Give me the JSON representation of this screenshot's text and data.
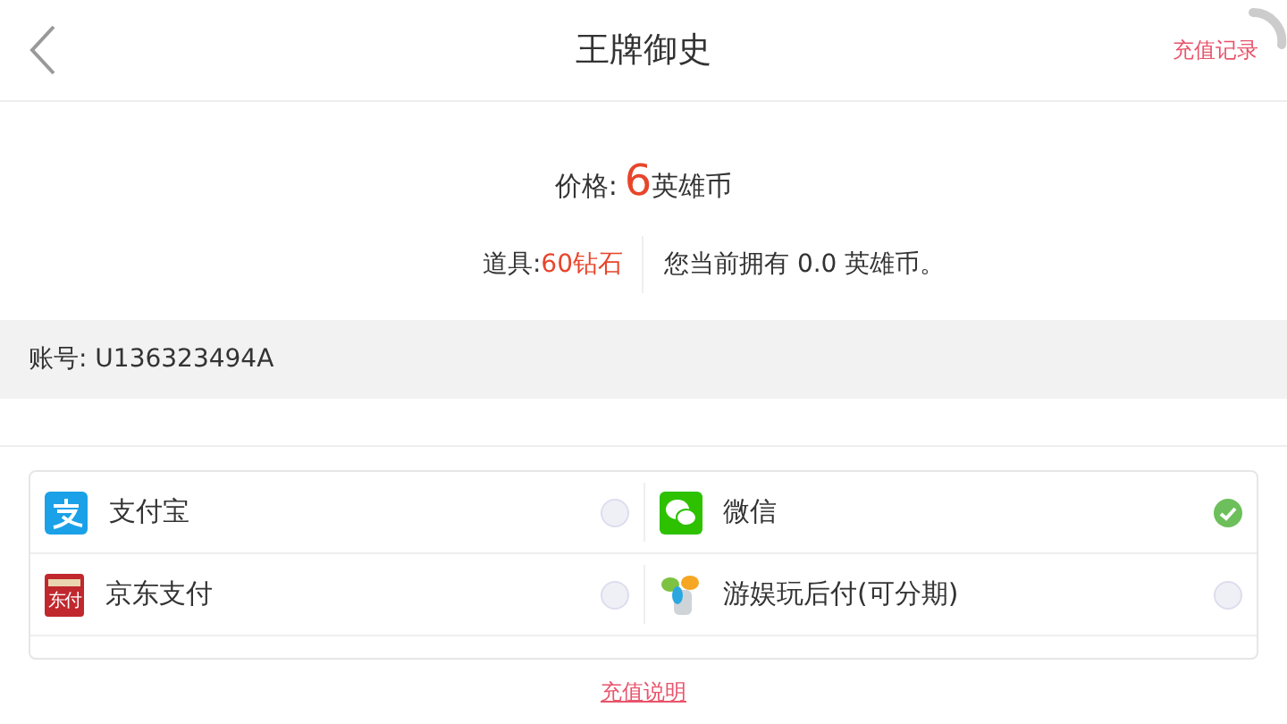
{
  "header": {
    "title": "王牌御史",
    "action": "充值记录"
  },
  "price": {
    "label": "价格:",
    "amount": "6",
    "unit": "英雄币"
  },
  "item": {
    "label": "道具:",
    "value": "60钻石",
    "balance": "您当前拥有 0.0 英雄币。"
  },
  "account": {
    "text": "账号: U136323494A"
  },
  "payment_methods": [
    {
      "kind": "alipay",
      "label": "支付宝",
      "selected": false
    },
    {
      "kind": "wechat",
      "label": "微信",
      "selected": true
    },
    {
      "kind": "jd",
      "label": "京东支付",
      "icon_text": "东付",
      "selected": false
    },
    {
      "kind": "youyu",
      "label": "游娱玩后付(可分期)",
      "selected": false
    }
  ],
  "footer_link": "充值说明"
}
